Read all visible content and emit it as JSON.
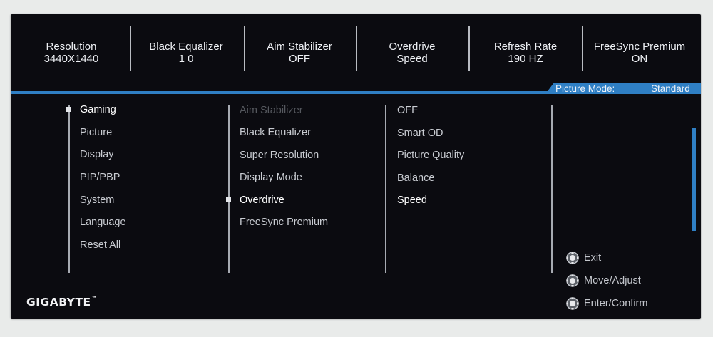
{
  "status_bar": [
    {
      "label": "Resolution",
      "value": "3440X1440"
    },
    {
      "label": "Black Equalizer",
      "value": "1 0"
    },
    {
      "label": "Aim Stabilizer",
      "value": "OFF"
    },
    {
      "label": "Overdrive",
      "value": "Speed"
    },
    {
      "label": "Refresh Rate",
      "value": "190 HZ"
    },
    {
      "label": "FreeSync Premium",
      "value": "ON"
    }
  ],
  "picture_mode": {
    "label": "Picture Mode:",
    "value": "Standard"
  },
  "main_menu": [
    "Gaming",
    "Picture",
    "Display",
    "PIP/PBP",
    "System",
    "Language",
    "Reset All"
  ],
  "sub_menu": [
    "Aim Stabilizer",
    "Black Equalizer",
    "Super Resolution",
    "Display Mode",
    "Overdrive",
    "FreeSync Premium"
  ],
  "options": [
    "OFF",
    "Smart OD",
    "Picture Quality",
    "Balance",
    "Speed"
  ],
  "help": [
    {
      "icon": "joystick-press-icon",
      "label": "Exit"
    },
    {
      "icon": "joystick-move-icon",
      "label": "Move/Adjust"
    },
    {
      "icon": "joystick-push-icon",
      "label": "Enter/Confirm"
    }
  ],
  "brand": {
    "name": "GIGABYTE",
    "tm": "™"
  },
  "colors": {
    "accent": "#2f7fc4",
    "background": "#0b0b10"
  }
}
